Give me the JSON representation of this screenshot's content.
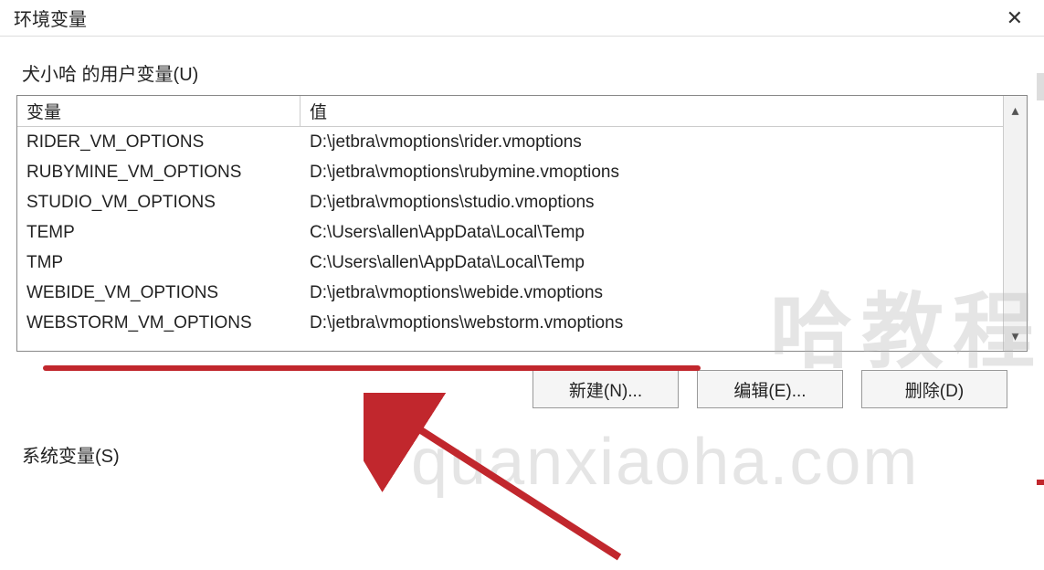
{
  "window": {
    "title": "环境变量"
  },
  "user_section": {
    "label": "犬小哈 的用户变量(U)",
    "headers": {
      "variable": "变量",
      "value": "值"
    },
    "rows": [
      {
        "variable": "RIDER_VM_OPTIONS",
        "value": "D:\\jetbra\\vmoptions\\rider.vmoptions"
      },
      {
        "variable": "RUBYMINE_VM_OPTIONS",
        "value": "D:\\jetbra\\vmoptions\\rubymine.vmoptions"
      },
      {
        "variable": "STUDIO_VM_OPTIONS",
        "value": "D:\\jetbra\\vmoptions\\studio.vmoptions"
      },
      {
        "variable": "TEMP",
        "value": "C:\\Users\\allen\\AppData\\Local\\Temp"
      },
      {
        "variable": "TMP",
        "value": "C:\\Users\\allen\\AppData\\Local\\Temp"
      },
      {
        "variable": "WEBIDE_VM_OPTIONS",
        "value": "D:\\jetbra\\vmoptions\\webide.vmoptions"
      },
      {
        "variable": "WEBSTORM_VM_OPTIONS",
        "value": "D:\\jetbra\\vmoptions\\webstorm.vmoptions"
      }
    ]
  },
  "buttons": {
    "new": "新建(N)...",
    "edit": "编辑(E)...",
    "delete": "删除(D)"
  },
  "system_section": {
    "label": "系统变量(S)"
  },
  "watermarks": {
    "w1": "哈教程",
    "w2": "quanxiaoha.com"
  }
}
